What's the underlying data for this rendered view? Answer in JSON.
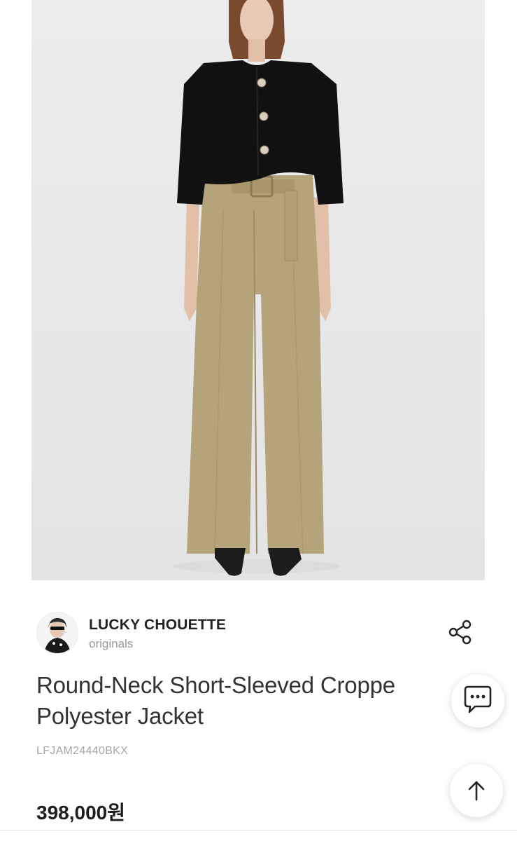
{
  "product": {
    "image_alt": "Model wearing black cropped jacket and beige wide-leg trousers"
  },
  "brand": {
    "name": "LUCKY CHOUETTE",
    "subtitle": "originals"
  },
  "title": {
    "line1": "Round-Neck Short-Sleeved Croppe",
    "line2": "Polyester Jacket"
  },
  "sku": "LFJAM24440BKX",
  "price": "398,000원",
  "icons": {
    "share": "share-icon",
    "chat": "chat-bubble-icon",
    "scroll_top": "arrow-up-icon"
  },
  "colors": {
    "text_primary": "#222222",
    "text_muted": "#9a9a9a",
    "jacket": "#111111",
    "trousers": "#b5a37b"
  }
}
